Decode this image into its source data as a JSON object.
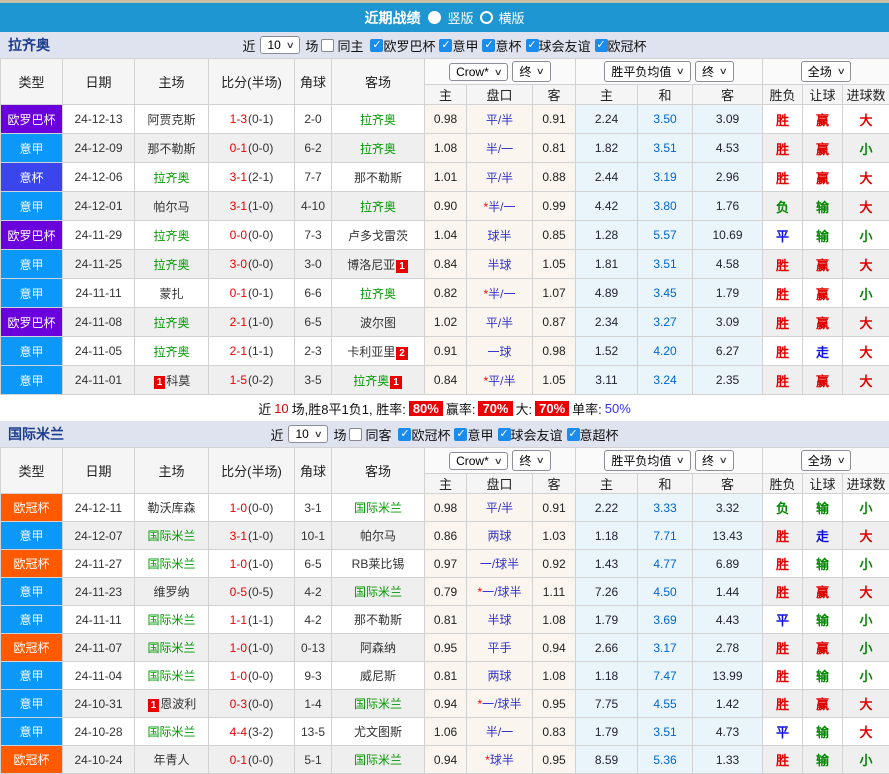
{
  "colors": {
    "topbar": "#1E96D2",
    "topstrip": "#C9C0A6",
    "section_bar": "#DEE3EF",
    "team_title": "#1B3C8F",
    "self_team_green": "#009900",
    "score_red": "#EE0000",
    "handicap_blue": "#3333CC",
    "avg_draw_blue": "#0066CC",
    "crow_bg": "#FAF5EE",
    "europe_bg": "#EAF4FB",
    "alt_row": "#EFEFEF",
    "badge_bg": "#E80000",
    "league": {
      "欧罗巴杯": "#6A00DC",
      "意甲": "#0A99FB",
      "意杯": "#3A45EE",
      "欧冠杯": "#FF5A00"
    },
    "result": {
      "胜": "#E00000",
      "平": "#1010E0",
      "负": "#008800",
      "赢": "#E00000",
      "走": "#1010E0",
      "输": "#008800",
      "大": "#E00000",
      "小": "#008800"
    }
  },
  "header": {
    "title": "近期战绩",
    "radios": [
      {
        "label": "竖版",
        "selected": true
      },
      {
        "label": "横版",
        "selected": false
      }
    ]
  },
  "labels": {
    "recent": "近",
    "matches": "场"
  },
  "theader": {
    "cols": [
      "类型",
      "日期",
      "主场",
      "比分(半场)",
      "角球",
      "客场"
    ],
    "dropdowns": {
      "crow": "Crow*",
      "end1": "终",
      "avg": "胜平负均值",
      "end2": "终",
      "full": "全场"
    },
    "sub": [
      "主",
      "盘口",
      "客",
      "主",
      "和",
      "客",
      "胜负",
      "让球",
      "进球数"
    ]
  },
  "sections": [
    {
      "team": "拉齐奥",
      "filter": {
        "count": "10",
        "same_label": "同主",
        "same_checked": false,
        "competitions": [
          {
            "label": "欧罗巴杯",
            "checked": true
          },
          {
            "label": "意甲",
            "checked": true
          },
          {
            "label": "意杯",
            "checked": true
          },
          {
            "label": "球会友谊",
            "checked": true
          },
          {
            "label": "欧冠杯",
            "checked": true
          }
        ]
      },
      "rows": [
        {
          "league": "欧罗巴杯",
          "date": "24-12-13",
          "home": "阿贾克斯",
          "home_badge": "",
          "home_self": false,
          "score": "1-3",
          "half": "(0-1)",
          "corners": "2-0",
          "away": "拉齐奥",
          "away_badge": "",
          "away_self": true,
          "o1": "0.98",
          "hc": "平/半",
          "star": false,
          "o2": "0.91",
          "e1": "2.24",
          "e2": "3.50",
          "e3": "3.09",
          "wdl": "胜",
          "let": "赢",
          "goal": "大"
        },
        {
          "league": "意甲",
          "date": "24-12-09",
          "home": "那不勒斯",
          "home_badge": "",
          "home_self": false,
          "score": "0-1",
          "half": "(0-0)",
          "corners": "6-2",
          "away": "拉齐奥",
          "away_badge": "",
          "away_self": true,
          "o1": "1.08",
          "hc": "半/一",
          "star": false,
          "o2": "0.81",
          "e1": "1.82",
          "e2": "3.51",
          "e3": "4.53",
          "wdl": "胜",
          "let": "赢",
          "goal": "小"
        },
        {
          "league": "意杯",
          "date": "24-12-06",
          "home": "拉齐奥",
          "home_badge": "",
          "home_self": true,
          "score": "3-1",
          "half": "(2-1)",
          "corners": "7-7",
          "away": "那不勒斯",
          "away_badge": "",
          "away_self": false,
          "o1": "1.01",
          "hc": "平/半",
          "star": false,
          "o2": "0.88",
          "e1": "2.44",
          "e2": "3.19",
          "e3": "2.96",
          "wdl": "胜",
          "let": "赢",
          "goal": "大"
        },
        {
          "league": "意甲",
          "date": "24-12-01",
          "home": "帕尔马",
          "home_badge": "",
          "home_self": false,
          "score": "3-1",
          "half": "(1-0)",
          "corners": "4-10",
          "away": "拉齐奥",
          "away_badge": "",
          "away_self": true,
          "o1": "0.90",
          "hc": "半/一",
          "star": true,
          "o2": "0.99",
          "e1": "4.42",
          "e2": "3.80",
          "e3": "1.76",
          "wdl": "负",
          "let": "输",
          "goal": "大"
        },
        {
          "league": "欧罗巴杯",
          "date": "24-11-29",
          "home": "拉齐奥",
          "home_badge": "",
          "home_self": true,
          "score": "0-0",
          "half": "(0-0)",
          "corners": "7-3",
          "away": "卢多戈雷茨",
          "away_badge": "",
          "away_self": false,
          "o1": "1.04",
          "hc": "球半",
          "star": false,
          "o2": "0.85",
          "e1": "1.28",
          "e2": "5.57",
          "e3": "10.69",
          "wdl": "平",
          "let": "输",
          "goal": "小"
        },
        {
          "league": "意甲",
          "date": "24-11-25",
          "home": "拉齐奥",
          "home_badge": "",
          "home_self": true,
          "score": "3-0",
          "half": "(0-0)",
          "corners": "3-0",
          "away": "博洛尼亚",
          "away_badge": "1",
          "away_self": false,
          "o1": "0.84",
          "hc": "半球",
          "star": false,
          "o2": "1.05",
          "e1": "1.81",
          "e2": "3.51",
          "e3": "4.58",
          "wdl": "胜",
          "let": "赢",
          "goal": "大"
        },
        {
          "league": "意甲",
          "date": "24-11-11",
          "home": "蒙扎",
          "home_badge": "",
          "home_self": false,
          "score": "0-1",
          "half": "(0-1)",
          "corners": "6-6",
          "away": "拉齐奥",
          "away_badge": "",
          "away_self": true,
          "o1": "0.82",
          "hc": "半/一",
          "star": true,
          "o2": "1.07",
          "e1": "4.89",
          "e2": "3.45",
          "e3": "1.79",
          "wdl": "胜",
          "let": "赢",
          "goal": "小"
        },
        {
          "league": "欧罗巴杯",
          "date": "24-11-08",
          "home": "拉齐奥",
          "home_badge": "",
          "home_self": true,
          "score": "2-1",
          "half": "(1-0)",
          "corners": "6-5",
          "away": "波尔图",
          "away_badge": "",
          "away_self": false,
          "o1": "1.02",
          "hc": "平/半",
          "star": false,
          "o2": "0.87",
          "e1": "2.34",
          "e2": "3.27",
          "e3": "3.09",
          "wdl": "胜",
          "let": "赢",
          "goal": "大"
        },
        {
          "league": "意甲",
          "date": "24-11-05",
          "home": "拉齐奥",
          "home_badge": "",
          "home_self": true,
          "score": "2-1",
          "half": "(1-1)",
          "corners": "2-3",
          "away": "卡利亚里",
          "away_badge": "2",
          "away_self": false,
          "o1": "0.91",
          "hc": "一球",
          "star": false,
          "o2": "0.98",
          "e1": "1.52",
          "e2": "4.20",
          "e3": "6.27",
          "wdl": "胜",
          "let": "走",
          "goal": "大"
        },
        {
          "league": "意甲",
          "date": "24-11-01",
          "home": "科莫",
          "home_badge": "1",
          "home_self": false,
          "score": "1-5",
          "half": "(0-2)",
          "corners": "3-5",
          "away": "拉齐奥",
          "away_badge": "1",
          "away_self": true,
          "o1": "0.84",
          "hc": "平/半",
          "star": true,
          "o2": "1.05",
          "e1": "3.11",
          "e2": "3.24",
          "e3": "2.35",
          "wdl": "胜",
          "let": "赢",
          "goal": "大"
        }
      ],
      "summary": [
        {
          "t": "近",
          "s": "plain"
        },
        {
          "t": "10",
          "s": "red"
        },
        {
          "t": "场,胜8平1负1, 胜率:",
          "s": "plain"
        },
        {
          "t": "80%",
          "s": "badge"
        },
        {
          "t": "赢率:",
          "s": "plain"
        },
        {
          "t": "70%",
          "s": "badge"
        },
        {
          "t": "大:",
          "s": "plain"
        },
        {
          "t": "70%",
          "s": "badge"
        },
        {
          "t": "单率:",
          "s": "plain"
        },
        {
          "t": "50%",
          "s": "blue"
        }
      ]
    },
    {
      "team": "国际米兰",
      "filter": {
        "count": "10",
        "same_label": "同客",
        "same_checked": false,
        "competitions": [
          {
            "label": "欧冠杯",
            "checked": true
          },
          {
            "label": "意甲",
            "checked": true
          },
          {
            "label": "球会友谊",
            "checked": true
          },
          {
            "label": "意超杯",
            "checked": true
          }
        ]
      },
      "rows": [
        {
          "league": "欧冠杯",
          "date": "24-12-11",
          "home": "勒沃库森",
          "home_badge": "",
          "home_self": false,
          "score": "1-0",
          "half": "(0-0)",
          "corners": "3-1",
          "away": "国际米兰",
          "away_badge": "",
          "away_self": true,
          "o1": "0.98",
          "hc": "平/半",
          "star": false,
          "o2": "0.91",
          "e1": "2.22",
          "e2": "3.33",
          "e3": "3.32",
          "wdl": "负",
          "let": "输",
          "goal": "小"
        },
        {
          "league": "意甲",
          "date": "24-12-07",
          "home": "国际米兰",
          "home_badge": "",
          "home_self": true,
          "score": "3-1",
          "half": "(1-0)",
          "corners": "10-1",
          "away": "帕尔马",
          "away_badge": "",
          "away_self": false,
          "o1": "0.86",
          "hc": "两球",
          "star": false,
          "o2": "1.03",
          "e1": "1.18",
          "e2": "7.71",
          "e3": "13.43",
          "wdl": "胜",
          "let": "走",
          "goal": "大"
        },
        {
          "league": "欧冠杯",
          "date": "24-11-27",
          "home": "国际米兰",
          "home_badge": "",
          "home_self": true,
          "score": "1-0",
          "half": "(1-0)",
          "corners": "6-5",
          "away": "RB莱比锡",
          "away_badge": "",
          "away_self": false,
          "o1": "0.97",
          "hc": "一/球半",
          "star": false,
          "o2": "0.92",
          "e1": "1.43",
          "e2": "4.77",
          "e3": "6.89",
          "wdl": "胜",
          "let": "输",
          "goal": "小"
        },
        {
          "league": "意甲",
          "date": "24-11-23",
          "home": "维罗纳",
          "home_badge": "",
          "home_self": false,
          "score": "0-5",
          "half": "(0-5)",
          "corners": "4-2",
          "away": "国际米兰",
          "away_badge": "",
          "away_self": true,
          "o1": "0.79",
          "hc": "一/球半",
          "star": true,
          "o2": "1.11",
          "e1": "7.26",
          "e2": "4.50",
          "e3": "1.44",
          "wdl": "胜",
          "let": "赢",
          "goal": "大"
        },
        {
          "league": "意甲",
          "date": "24-11-11",
          "home": "国际米兰",
          "home_badge": "",
          "home_self": true,
          "score": "1-1",
          "half": "(1-1)",
          "corners": "4-2",
          "away": "那不勒斯",
          "away_badge": "",
          "away_self": false,
          "o1": "0.81",
          "hc": "半球",
          "star": false,
          "o2": "1.08",
          "e1": "1.79",
          "e2": "3.69",
          "e3": "4.43",
          "wdl": "平",
          "let": "输",
          "goal": "小"
        },
        {
          "league": "欧冠杯",
          "date": "24-11-07",
          "home": "国际米兰",
          "home_badge": "",
          "home_self": true,
          "score": "1-0",
          "half": "(1-0)",
          "corners": "0-13",
          "away": "阿森纳",
          "away_badge": "",
          "away_self": false,
          "o1": "0.95",
          "hc": "平手",
          "star": false,
          "o2": "0.94",
          "e1": "2.66",
          "e2": "3.17",
          "e3": "2.78",
          "wdl": "胜",
          "let": "赢",
          "goal": "小"
        },
        {
          "league": "意甲",
          "date": "24-11-04",
          "home": "国际米兰",
          "home_badge": "",
          "home_self": true,
          "score": "1-0",
          "half": "(0-0)",
          "corners": "9-3",
          "away": "威尼斯",
          "away_badge": "",
          "away_self": false,
          "o1": "0.81",
          "hc": "两球",
          "star": false,
          "o2": "1.08",
          "e1": "1.18",
          "e2": "7.47",
          "e3": "13.99",
          "wdl": "胜",
          "let": "输",
          "goal": "小"
        },
        {
          "league": "意甲",
          "date": "24-10-31",
          "home": "恩波利",
          "home_badge": "1",
          "home_self": false,
          "score": "0-3",
          "half": "(0-0)",
          "corners": "1-4",
          "away": "国际米兰",
          "away_badge": "",
          "away_self": true,
          "o1": "0.94",
          "hc": "一/球半",
          "star": true,
          "o2": "0.95",
          "e1": "7.75",
          "e2": "4.55",
          "e3": "1.42",
          "wdl": "胜",
          "let": "赢",
          "goal": "大"
        },
        {
          "league": "意甲",
          "date": "24-10-28",
          "home": "国际米兰",
          "home_badge": "",
          "home_self": true,
          "score": "4-4",
          "half": "(3-2)",
          "corners": "13-5",
          "away": "尤文图斯",
          "away_badge": "",
          "away_self": false,
          "o1": "1.06",
          "hc": "半/一",
          "star": false,
          "o2": "0.83",
          "e1": "1.79",
          "e2": "3.51",
          "e3": "4.73",
          "wdl": "平",
          "let": "输",
          "goal": "大"
        },
        {
          "league": "欧冠杯",
          "date": "24-10-24",
          "home": "年青人",
          "home_badge": "",
          "home_self": false,
          "score": "0-1",
          "half": "(0-0)",
          "corners": "5-1",
          "away": "国际米兰",
          "away_badge": "",
          "away_self": true,
          "o1": "0.94",
          "hc": "球半",
          "star": true,
          "o2": "0.95",
          "e1": "8.59",
          "e2": "5.36",
          "e3": "1.33",
          "wdl": "胜",
          "let": "输",
          "goal": "小"
        }
      ],
      "summary": []
    }
  ]
}
